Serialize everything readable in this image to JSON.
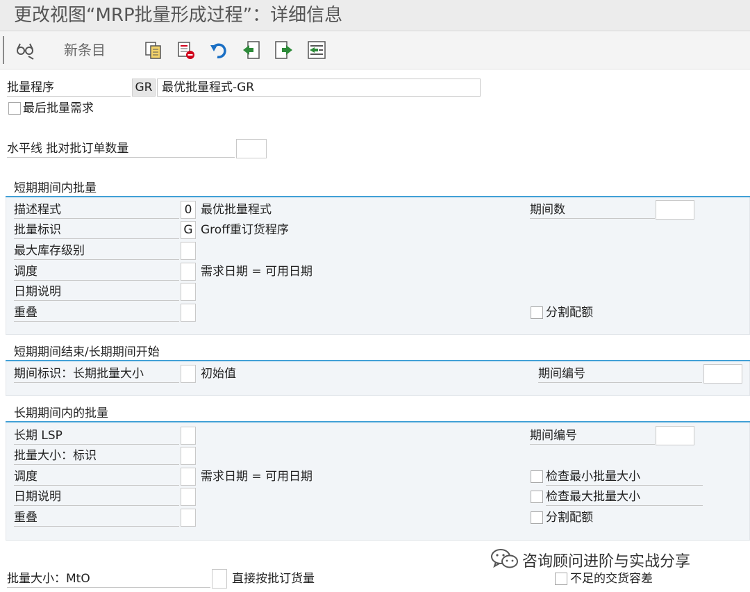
{
  "title": "更改视图“MRP批量形成过程”：详细信息",
  "toolbar": {
    "new_entries": "新条目"
  },
  "header": {
    "lot_procedure_label": "批量程序",
    "lot_procedure_code": "GR",
    "lot_procedure_desc": "最优批量程式-GR",
    "last_lot_label": "最后批量需求",
    "horizon_label": "水平线 批对批订单数量",
    "horizon_value": ""
  },
  "short_term": {
    "title": "短期期间内批量",
    "desc_label": "描述程式",
    "desc_value": "0",
    "desc_text": "最优批量程式",
    "periods_label": "期间数",
    "periods_value": "",
    "lot_id_label": "批量标识",
    "lot_id_value": "G",
    "lot_id_text": "Groff重订货程序",
    "max_stock_label": "最大库存级别",
    "max_stock_value": "",
    "schedule_label": "调度",
    "schedule_value": "",
    "schedule_text": "需求日期 = 可用日期",
    "date_desc_label": "日期说明",
    "date_desc_value": "",
    "overlap_label": "重叠",
    "overlap_value": "",
    "split_quota_label": "分割配额"
  },
  "transition": {
    "title": "短期期间结束/长期期间开始",
    "period_id_label": "期间标识：长期批量大小",
    "period_id_value": "",
    "period_id_text": "初始值",
    "period_no_label": "期间编号",
    "period_no_value": ""
  },
  "long_term": {
    "title": "长期期间内的批量",
    "lsp_label": "长期 LSP",
    "lsp_value": "",
    "period_no_label": "期间编号",
    "period_no_value": "",
    "lot_size_label": "批量大小：标识",
    "lot_size_value": "",
    "schedule_label": "调度",
    "schedule_value": "",
    "schedule_text": "需求日期 = 可用日期",
    "check_min_label": "检查最小批量大小",
    "date_desc_label": "日期说明",
    "date_desc_value": "",
    "check_max_label": "检查最大批量大小",
    "overlap_label": "重叠",
    "overlap_value": "",
    "split_quota_label": "分割配额"
  },
  "footer": {
    "mto_label": "批量大小：MtO",
    "mto_value": "",
    "mto_text": "直接按批订货量",
    "under_tol_label": "不足的交货容差"
  },
  "watermark": "咨询顾问进阶与实战分享",
  "icons": [
    "glasses-icon",
    "copy-icon",
    "delete-icon",
    "undo-icon",
    "prev-entry-icon",
    "next-entry-icon",
    "select-block-icon",
    "wechat-icon"
  ],
  "colors": {
    "accent": "#41a0d6",
    "toolbar_icon_green": "#2e8b3a",
    "toolbar_icon_blue": "#1a6fc4",
    "delete_red": "#d0021b"
  }
}
